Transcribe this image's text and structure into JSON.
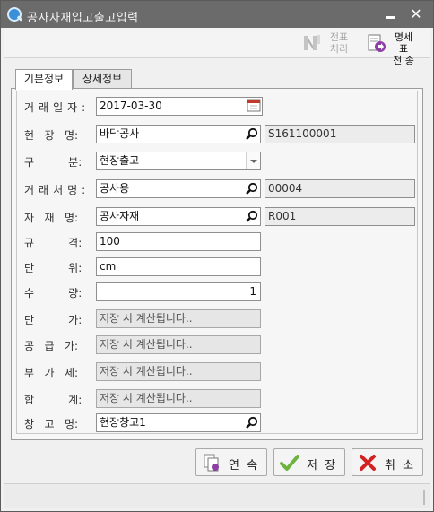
{
  "window": {
    "title": "공사자재입고출고입력",
    "minimize_label": "_",
    "close_label": "✕"
  },
  "toolbar": {
    "slip_label_line1": "전표",
    "slip_label_line2": "처리",
    "send_label_line1": "명세표",
    "send_label_line2": "전 송"
  },
  "tabs": [
    {
      "label": "기본정보",
      "active": true
    },
    {
      "label": "상세정보",
      "active": false
    }
  ],
  "form": {
    "trade_date": {
      "label": "거래일자:",
      "value": "2017-03-30"
    },
    "site": {
      "label": "현   장   명:",
      "value": "바닥공사",
      "code": "S161100001"
    },
    "category": {
      "label": "구          분:",
      "value": "현장출고"
    },
    "customer": {
      "label": "거래처명:",
      "value": "공사용",
      "code": "00004"
    },
    "material": {
      "label": "자   재   명:",
      "value": "공사자재",
      "code": "R001"
    },
    "spec": {
      "label": "규          격:",
      "value": "100"
    },
    "unit": {
      "label": "단          위:",
      "value": "cm"
    },
    "quantity": {
      "label": "수          량:",
      "value": "1"
    },
    "unit_price": {
      "label": "단          가:",
      "placeholder": "저장 시 계산됩니다.."
    },
    "supply_amount": {
      "label": "공   급   가:",
      "placeholder": "저장 시 계산됩니다.."
    },
    "vat": {
      "label": "부   가   세:",
      "placeholder": "저장 시 계산됩니다.."
    },
    "total": {
      "label": "합          계:",
      "placeholder": "저장 시 계산됩니다.."
    },
    "warehouse": {
      "label": "창   고   명:",
      "value": "현장창고1"
    }
  },
  "buttons": {
    "continue_label": "연 속",
    "save_label": "저 장",
    "cancel_label": "취 소"
  },
  "colors": {
    "titlebar": "#6b6b6b",
    "save_check": "#6db33f",
    "cancel_x": "#d42020",
    "calendar_red": "#c0392b"
  },
  "icons": {
    "calendar": "calendar-icon",
    "search": "search-icon",
    "slip": "document-slip-icon",
    "send": "send-statement-icon",
    "continue": "copy-document-icon",
    "save": "checkmark-icon",
    "cancel": "cross-icon"
  }
}
